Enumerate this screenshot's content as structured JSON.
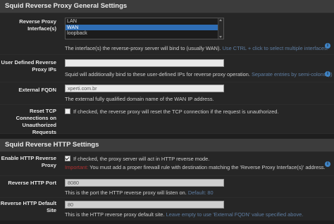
{
  "general": {
    "title": "Squid Reverse Proxy General Settings",
    "interfaces": {
      "label": "Reverse Proxy Interface(s)",
      "options": [
        "LAN",
        "WAN",
        "loopback"
      ],
      "selected": "WAN",
      "help": "The interface(s) the reverse-proxy server will bind to (usually WAN).",
      "help_note": "Use CTRL + click to select multiple interfaces."
    },
    "user_ips": {
      "label": "User Defined Reverse Proxy IPs",
      "value": "",
      "help": "Squid will additionally bind to these user-defined IPs for reverse proxy operation.",
      "help_note": "Separate entries by semi-colons (;)"
    },
    "fqdn": {
      "label": "External FQDN",
      "placeholder": "xperti.com.br",
      "help": "The external fully qualified domain name of the WAN IP address."
    },
    "reset_tcp": {
      "label": "Reset TCP Connections on Unauthorized Requests",
      "checked": false,
      "text": "If checked, the reverse proxy will reset the TCP connection if the request is unauthorized."
    }
  },
  "http": {
    "title": "Squid Reverse HTTP Settings",
    "enable": {
      "label": "Enable HTTP Reverse Proxy",
      "checked": true,
      "text": "If checked, the proxy server will act in HTTP reverse mode.",
      "important": "Important:",
      "important_text": "You must add a proper firewall rule with destination matching the 'Reverse Proxy Interface(s)' address."
    },
    "port": {
      "label": "Reverse HTTP Port",
      "value": "8080",
      "help": "This is the port the HTTP reverse proxy will listen on.",
      "help_note": "Default: 80"
    },
    "default_site": {
      "label": "Reverse HTTP Default Site",
      "value": "80",
      "help": "This is the HTTP reverse proxy default site.",
      "help_note": "Leave empty to use 'External FQDN' value specified above."
    }
  },
  "icons": {
    "info": "info-icon",
    "check": "check-icon"
  },
  "colors": {
    "accent": "#2e6db5",
    "note": "#5f7ea3",
    "warning": "#b03030"
  }
}
